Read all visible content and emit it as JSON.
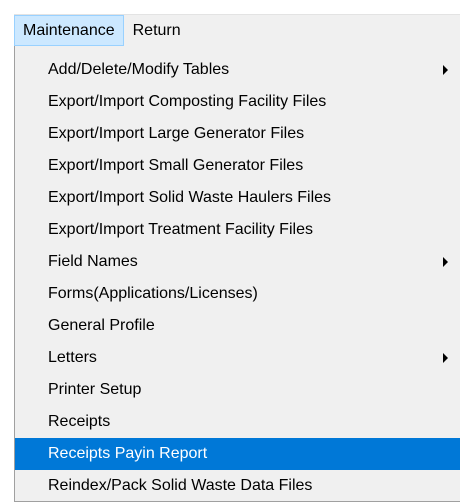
{
  "menubar": {
    "items": [
      {
        "label": "Maintenance",
        "active": true
      },
      {
        "label": "Return",
        "active": false
      }
    ]
  },
  "dropdown": {
    "items": [
      {
        "label": "Add/Delete/Modify Tables",
        "submenu": true
      },
      {
        "label": "Export/Import Composting Facility Files",
        "submenu": false
      },
      {
        "label": "Export/Import Large Generator Files",
        "submenu": false
      },
      {
        "label": "Export/Import Small Generator Files",
        "submenu": false
      },
      {
        "label": "Export/Import Solid Waste Haulers Files",
        "submenu": false
      },
      {
        "label": "Export/Import Treatment Facility Files",
        "submenu": false
      },
      {
        "label": "Field Names",
        "submenu": true
      },
      {
        "label": "Forms(Applications/Licenses)",
        "submenu": false
      },
      {
        "label": "General Profile",
        "submenu": false
      },
      {
        "label": "Letters",
        "submenu": true
      },
      {
        "label": "Printer Setup",
        "submenu": false
      },
      {
        "label": "Receipts",
        "submenu": false
      },
      {
        "label": "Receipts Payin Report",
        "submenu": false,
        "highlighted": true
      },
      {
        "label": "Reindex/Pack Solid Waste Data Files",
        "submenu": false
      }
    ]
  },
  "colors": {
    "menu_background": "#f0f0f0",
    "highlight": "#0078d7",
    "active_menubar": "#cce8ff"
  },
  "icons": {
    "submenu": "chevron-right-icon"
  }
}
